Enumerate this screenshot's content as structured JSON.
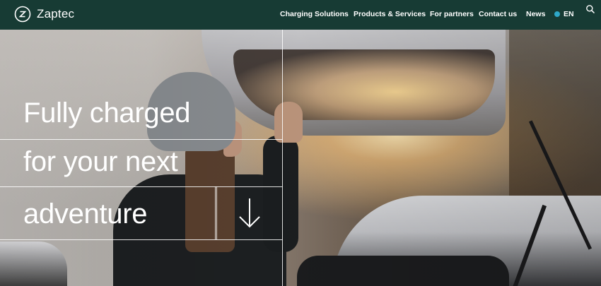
{
  "header": {
    "brand": "Zaptec",
    "nav": [
      {
        "label": "Charging Solutions"
      },
      {
        "label": "Products & Services"
      },
      {
        "label": "For partners"
      },
      {
        "label": "Contact us"
      },
      {
        "label": "News"
      }
    ],
    "language": "EN",
    "search_icon": "search-icon",
    "colors": {
      "header_bg": "#173b34",
      "text": "#ffffff",
      "globe": "#2ea8c9"
    }
  },
  "hero": {
    "headline_lines": [
      "Fully charged",
      "for your next",
      "adventure"
    ],
    "scroll_icon": "arrow-down-icon"
  }
}
